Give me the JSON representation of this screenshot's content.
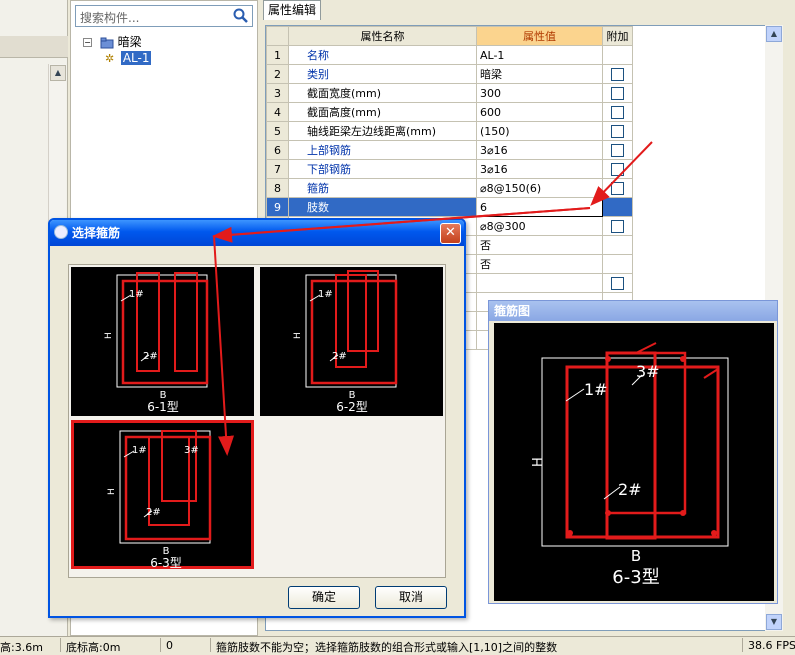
{
  "tree": {
    "search_placeholder": "搜索构件...",
    "root_label": "暗梁",
    "child_label": "AL-1",
    "expand_symbol": "−"
  },
  "props": {
    "tab_label": "属性编辑",
    "columns": [
      "属性名称",
      "属性值",
      "附加"
    ],
    "rows": [
      {
        "n": "1",
        "name": "名称",
        "value": "AL-1",
        "blue": true,
        "check": false
      },
      {
        "n": "2",
        "name": "类别",
        "value": "暗梁",
        "blue": true,
        "check": true
      },
      {
        "n": "3",
        "name": "截面宽度(mm)",
        "value": "300",
        "blue": false,
        "check": true
      },
      {
        "n": "4",
        "name": "截面高度(mm)",
        "value": "600",
        "blue": false,
        "check": true
      },
      {
        "n": "5",
        "name": "轴线距梁左边线距离(mm)",
        "value": "(150)",
        "blue": false,
        "check": true
      },
      {
        "n": "6",
        "name": "上部钢筋",
        "value": "3⌀16",
        "blue": true,
        "check": true
      },
      {
        "n": "7",
        "name": "下部钢筋",
        "value": "3⌀16",
        "blue": true,
        "check": true
      },
      {
        "n": "8",
        "name": "箍筋",
        "value": "⌀8@150(6)",
        "blue": true,
        "check": true
      },
      {
        "n": "9",
        "name": "肢数",
        "value": "6",
        "blue": false,
        "check": false,
        "hl": true
      },
      {
        "n": "",
        "name": "",
        "value": "⌀8@300",
        "blue": false,
        "check": true
      },
      {
        "n": "",
        "name": "",
        "value": "否",
        "blue": false,
        "check": false
      },
      {
        "n": "",
        "name": "",
        "value": "否",
        "blue": false,
        "check": false
      },
      {
        "n": "",
        "name": "",
        "value": "",
        "blue": false,
        "check": true
      },
      {
        "n": "",
        "name": "",
        "value": "",
        "blue": false,
        "check": false
      },
      {
        "n": "",
        "name": "",
        "value": "",
        "blue": false,
        "check": false
      },
      {
        "n": "",
        "name": "",
        "value": "",
        "blue": false,
        "check": false
      }
    ]
  },
  "dialog": {
    "title": "选择箍筋",
    "close_symbol": "✕",
    "tiles": [
      {
        "label": "6-1型",
        "h": "H",
        "b": "B",
        "m1": "1#",
        "m2": "2#",
        "m3": ""
      },
      {
        "label": "6-2型",
        "h": "H",
        "b": "B",
        "m1": "1#",
        "m2": "2#",
        "m3": ""
      },
      {
        "label": "6-3型",
        "h": "H",
        "b": "B",
        "m1": "1#",
        "m2": "2#",
        "m3": "3#"
      }
    ],
    "ok_label": "确定",
    "cancel_label": "取消"
  },
  "preview": {
    "title": "箍筋图",
    "label": "6-3型",
    "h": "H",
    "b": "B",
    "m1": "1#",
    "m2": "2#",
    "m3": "3#"
  },
  "status": {
    "cells": [
      "高:3.6m",
      "底标高:0m",
      "0",
      "箍筋肢数不能为空；选择箍筋肢数的组合形式或输入[1,10]之间的整数",
      "38.6 FPS"
    ]
  },
  "colors": {
    "accent": "#0054e3",
    "selection": "#316ac5",
    "arrow": "#e21b1b",
    "rebar": "#e21b1b"
  }
}
